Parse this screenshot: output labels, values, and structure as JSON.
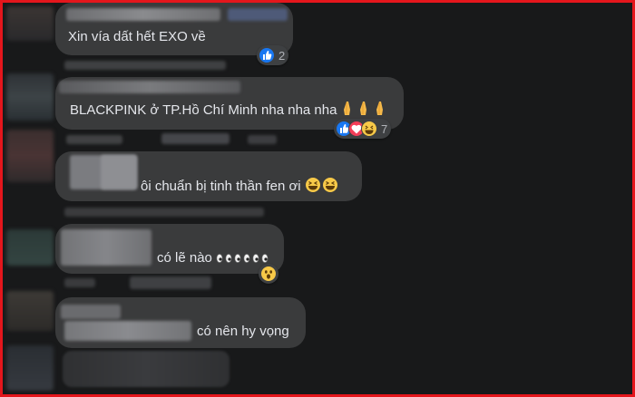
{
  "comments": [
    {
      "text": "Xin vía dất hết EXO về",
      "reaction_count": "2"
    },
    {
      "text": "BLACKPINK ở TP.Hồ Chí Minh nha nha nha",
      "reaction_count": "7"
    },
    {
      "text": "ôi chuẩn bị tinh thần fen ơi"
    },
    {
      "text": "có lẽ nào"
    },
    {
      "text": "có nên hy vọng"
    }
  ],
  "icons": {
    "like": "like-reaction-icon",
    "love": "love-reaction-icon",
    "haha": "haha-reaction-icon",
    "wow": "wow-reaction-icon",
    "pray": "folded-hands-emoji",
    "laugh": "grinning-squinting-emoji",
    "eyes": "eyes-emoji"
  },
  "colors": {
    "background": "#18191a",
    "bubble": "#3a3b3c",
    "text": "#e4e6eb",
    "like_blue": "#1877f2",
    "love_red": "#f33e58",
    "border_red": "#e4161c"
  }
}
